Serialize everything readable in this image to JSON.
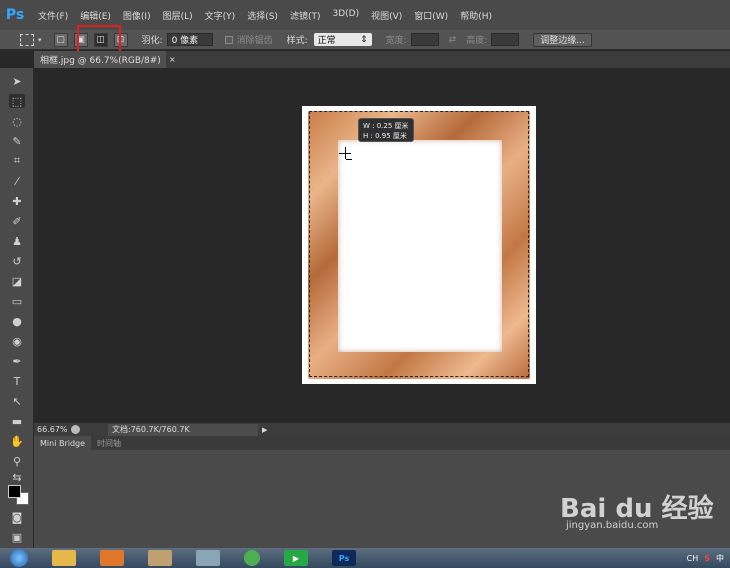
{
  "app": {
    "logo": "Ps"
  },
  "menu": [
    "文件(F)",
    "编辑(E)",
    "图像(I)",
    "图层(L)",
    "文字(Y)",
    "选择(S)",
    "滤镜(T)",
    "3D(D)",
    "视图(V)",
    "窗口(W)",
    "帮助(H)"
  ],
  "options": {
    "feather_label": "羽化:",
    "feather_value": "0 像素",
    "antialias_label": "消除锯齿",
    "style_label": "样式:",
    "style_value": "正常",
    "width_label": "宽度:",
    "height_label": "高度:",
    "refine_button": "调整边缘..."
  },
  "document_tab": {
    "title": "相框.jpg @ 66.7%(RGB/8#)",
    "close": "×"
  },
  "tooltip": {
    "w": "W : 0.25 厘米",
    "h": "H : 0.95 厘米"
  },
  "status": {
    "zoom": "66.67%",
    "doc_info": "文档:760.7K/760.7K"
  },
  "panel": {
    "tabs": [
      "Mini Bridge",
      "时间轴"
    ]
  },
  "watermark": {
    "brand": "Bai du 经验",
    "url": "jingyan.baidu.com"
  },
  "taskbar": {
    "ps_label": "Ps",
    "ime": "CH",
    "ime2": "中"
  },
  "colors": {
    "accent": "#31a8ff",
    "highlight": "#e02020",
    "frame": "#d4905a"
  }
}
